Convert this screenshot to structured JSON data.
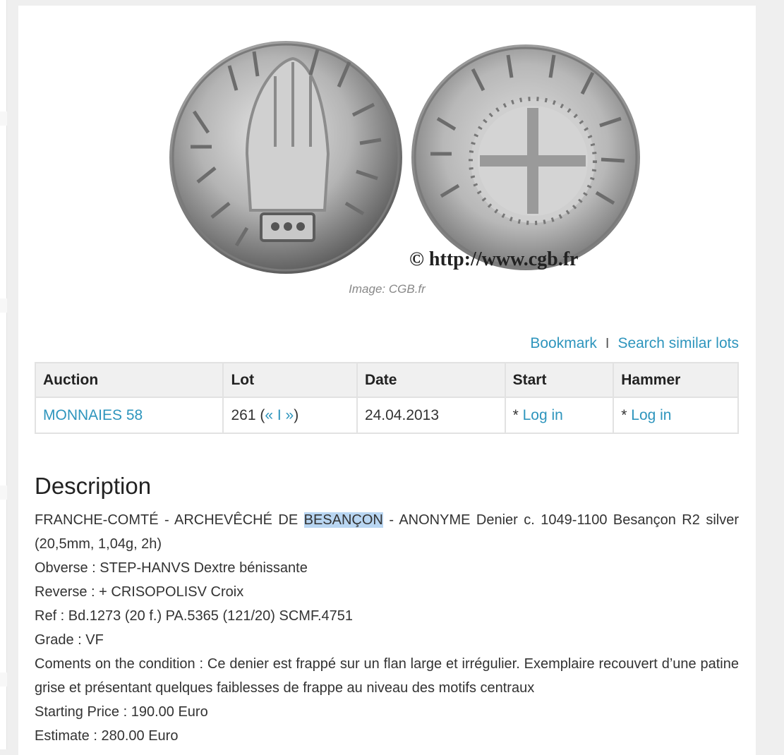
{
  "image": {
    "watermark": "© http://www.cgb.fr",
    "caption": "Image: CGB.fr"
  },
  "actions": {
    "bookmark": "Bookmark",
    "separator": "I",
    "search_similar": "Search similar lots"
  },
  "table": {
    "headers": [
      "Auction",
      "Lot",
      "Date",
      "Start",
      "Hammer"
    ],
    "row": {
      "auction": "MONNAIES 58",
      "lot_number": "261 (",
      "lot_prev": "«",
      "lot_sep": " I ",
      "lot_next": "»",
      "lot_close": ")",
      "date": "24.04.2013",
      "start_prefix": "* ",
      "start_link": "Log in",
      "hammer_prefix": "* ",
      "hammer_link": "Log in"
    }
  },
  "description": {
    "title": "Description",
    "line1_pre": "FRANCHE-COMTÉ - ARCHEVÊCHÉ DE ",
    "line1_highlight": "BESANÇON",
    "line1_post": " - ANONYME Denier c. 1049-1100 Besançon R2 silver (20,5mm, 1,04g, 2h)",
    "obverse": "Obverse : STEP-HANVS Dextre bénissante",
    "reverse": "Reverse : + CRISOPOLISV Croix",
    "ref": "Ref : Bd.1273 (20 f.) PA.5365 (121/20) SCMF.4751",
    "grade": "Grade : VF",
    "comments": "Coments on the condition : Ce denier est frappé sur un flan large et irrégulier. Exemplaire recouvert d’une patine grise et présentant quelques faiblesses de frappe au niveau des motifs centraux",
    "starting_price": "Starting Price : 190.00 Euro",
    "estimate": "Estimate : 280.00 Euro"
  },
  "colors": {
    "link": "#2e95bd",
    "highlight": "#b9d6f2",
    "header_bg": "#f0f0f0"
  }
}
